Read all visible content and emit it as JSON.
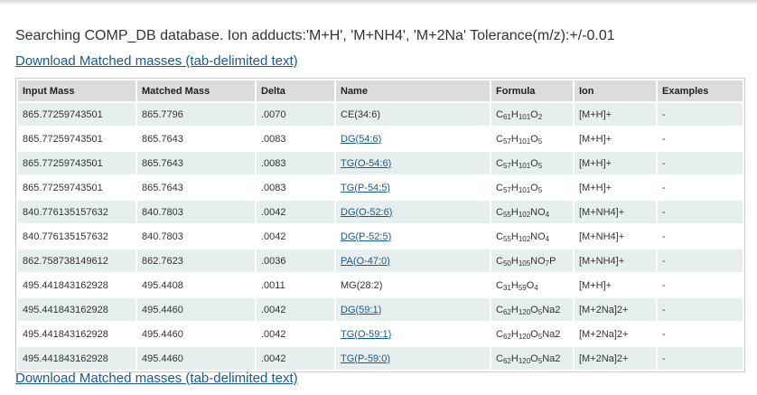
{
  "heading": "Searching COMP_DB database. Ion adducts:'M+H', 'M+NH4', 'M+2Na' Tolerance(m/z):+/-0.01",
  "download_label": "Download Matched masses (tab-delimited text)",
  "columns": [
    "Input Mass",
    "Matched Mass",
    "Delta",
    "Name",
    "Formula",
    "Ion",
    "Examples"
  ],
  "rows": [
    {
      "input_mass": "865.77259743501",
      "matched_mass": "865.7796",
      "delta": ".0070",
      "name": "CE(34:6)",
      "name_is_link": false,
      "formula": [
        [
          "C",
          ""
        ],
        [
          "61",
          "sub"
        ],
        [
          "H",
          ""
        ],
        [
          "101",
          "sub"
        ],
        [
          "O",
          ""
        ],
        [
          "2",
          "sub"
        ]
      ],
      "ion": "[M+H]+",
      "examples": "-"
    },
    {
      "input_mass": "865.77259743501",
      "matched_mass": "865.7643",
      "delta": ".0083",
      "name": "DG(54:6)",
      "name_is_link": true,
      "formula": [
        [
          "C",
          ""
        ],
        [
          "57",
          "sub"
        ],
        [
          "H",
          ""
        ],
        [
          "101",
          "sub"
        ],
        [
          "O",
          ""
        ],
        [
          "5",
          "sub"
        ]
      ],
      "ion": "[M+H]+",
      "examples": "-"
    },
    {
      "input_mass": "865.77259743501",
      "matched_mass": "865.7643",
      "delta": ".0083",
      "name": "TG(O-54:6)",
      "name_is_link": true,
      "formula": [
        [
          "C",
          ""
        ],
        [
          "57",
          "sub"
        ],
        [
          "H",
          ""
        ],
        [
          "101",
          "sub"
        ],
        [
          "O",
          ""
        ],
        [
          "5",
          "sub"
        ]
      ],
      "ion": "[M+H]+",
      "examples": "-"
    },
    {
      "input_mass": "865.77259743501",
      "matched_mass": "865.7643",
      "delta": ".0083",
      "name": "TG(P-54:5)",
      "name_is_link": true,
      "formula": [
        [
          "C",
          ""
        ],
        [
          "57",
          "sub"
        ],
        [
          "H",
          ""
        ],
        [
          "101",
          "sub"
        ],
        [
          "O",
          ""
        ],
        [
          "5",
          "sub"
        ]
      ],
      "ion": "[M+H]+",
      "examples": "-"
    },
    {
      "input_mass": "840.776135157632",
      "matched_mass": "840.7803",
      "delta": ".0042",
      "name": "DG(O-52:6)",
      "name_is_link": true,
      "formula": [
        [
          "C",
          ""
        ],
        [
          "55",
          "sub"
        ],
        [
          "H",
          ""
        ],
        [
          "102",
          "sub"
        ],
        [
          "NO",
          ""
        ],
        [
          "4",
          "sub"
        ]
      ],
      "ion": "[M+NH4]+",
      "examples": "-"
    },
    {
      "input_mass": "840.776135157632",
      "matched_mass": "840.7803",
      "delta": ".0042",
      "name": "DG(P-52:5)",
      "name_is_link": true,
      "formula": [
        [
          "C",
          ""
        ],
        [
          "55",
          "sub"
        ],
        [
          "H",
          ""
        ],
        [
          "102",
          "sub"
        ],
        [
          "NO",
          ""
        ],
        [
          "4",
          "sub"
        ]
      ],
      "ion": "[M+NH4]+",
      "examples": "-"
    },
    {
      "input_mass": "862.758738149612",
      "matched_mass": "862.7623",
      "delta": ".0036",
      "name": "PA(O-47:0)",
      "name_is_link": true,
      "formula": [
        [
          "C",
          ""
        ],
        [
          "50",
          "sub"
        ],
        [
          "H",
          ""
        ],
        [
          "105",
          "sub"
        ],
        [
          "NO",
          ""
        ],
        [
          "7",
          "sub"
        ],
        [
          "P",
          ""
        ]
      ],
      "ion": "[M+NH4]+",
      "examples": "-"
    },
    {
      "input_mass": "495.441843162928",
      "matched_mass": "495.4408",
      "delta": ".0011",
      "name": "MG(28:2)",
      "name_is_link": false,
      "formula": [
        [
          "C",
          ""
        ],
        [
          "31",
          "sub"
        ],
        [
          "H",
          ""
        ],
        [
          "59",
          "sub"
        ],
        [
          "O",
          ""
        ],
        [
          "4",
          "sub"
        ]
      ],
      "ion": "[M+H]+",
      "examples": "-"
    },
    {
      "input_mass": "495.441843162928",
      "matched_mass": "495.4460",
      "delta": ".0042",
      "name": "DG(59:1)",
      "name_is_link": true,
      "formula": [
        [
          "C",
          ""
        ],
        [
          "62",
          "sub"
        ],
        [
          "H",
          ""
        ],
        [
          "120",
          "sub"
        ],
        [
          "O",
          ""
        ],
        [
          "5",
          "sub"
        ],
        [
          "Na2",
          ""
        ]
      ],
      "ion": "[M+2Na]2+",
      "examples": "-"
    },
    {
      "input_mass": "495.441843162928",
      "matched_mass": "495.4460",
      "delta": ".0042",
      "name": "TG(O-59:1)",
      "name_is_link": true,
      "formula": [
        [
          "C",
          ""
        ],
        [
          "62",
          "sub"
        ],
        [
          "H",
          ""
        ],
        [
          "120",
          "sub"
        ],
        [
          "O",
          ""
        ],
        [
          "5",
          "sub"
        ],
        [
          "Na2",
          ""
        ]
      ],
      "ion": "[M+2Na]2+",
      "examples": "-"
    },
    {
      "input_mass": "495.441843162928",
      "matched_mass": "495.4460",
      "delta": ".0042",
      "name": "TG(P-59:0)",
      "name_is_link": true,
      "formula": [
        [
          "C",
          ""
        ],
        [
          "62",
          "sub"
        ],
        [
          "H",
          ""
        ],
        [
          "120",
          "sub"
        ],
        [
          "O",
          ""
        ],
        [
          "5",
          "sub"
        ],
        [
          "Na2",
          ""
        ]
      ],
      "ion": "[M+2Na]2+",
      "examples": "-"
    }
  ]
}
